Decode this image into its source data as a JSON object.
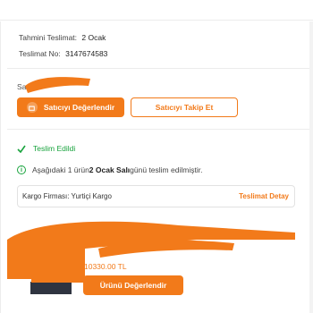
{
  "shipment": {
    "estimated_delivery_label": "Tahmini Teslimat:",
    "estimated_delivery_value": "2 Ocak",
    "delivery_no_label": "Teslimat No:",
    "delivery_no_value": "3147674583"
  },
  "seller": {
    "label_prefix": "Sa",
    "rate_seller_button": "Satıcıyı Değerlendir",
    "follow_seller_button": "Satıcıyı Takip Et"
  },
  "status": {
    "text": "Teslim Edildi"
  },
  "notice": {
    "prefix": "Aşağıdaki 1 ürün ",
    "highlight": "2 Ocak Salı",
    "suffix": " günü teslim edilmiştir."
  },
  "cargo": {
    "label": "Kargo Firması:",
    "company": "Yurtiçi Kargo",
    "detail_link": "Teslimat Detay"
  },
  "product": {
    "price": "10330.00 TL",
    "review_button": "Ürünü Değerlendir"
  },
  "colors": {
    "accent": "#f27a1a",
    "success": "#18a33d"
  }
}
